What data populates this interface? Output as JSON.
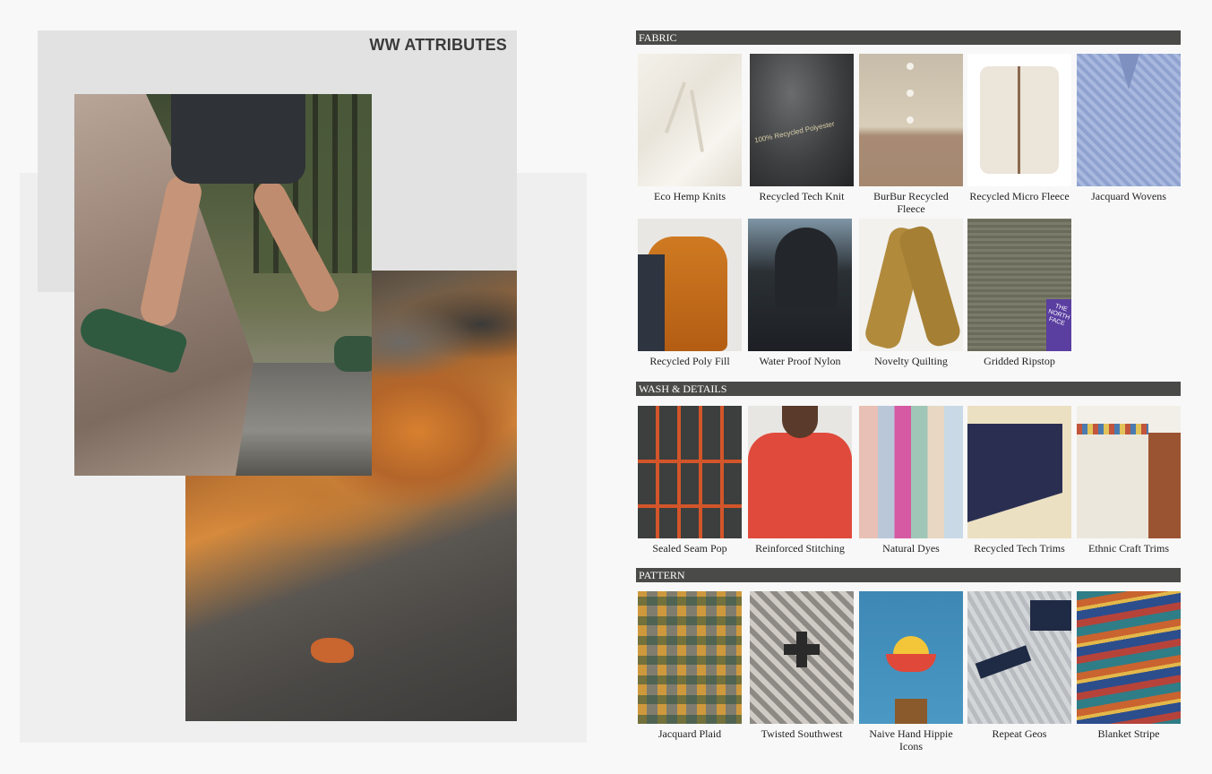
{
  "page_title": "WW ATTRIBUTES",
  "sections": {
    "fabric": {
      "label": "FABRIC",
      "items": [
        {
          "caption": "Eco Hemp Knits"
        },
        {
          "caption": "Recycled Tech Knit"
        },
        {
          "caption": "BurBur Recycled Fleece"
        },
        {
          "caption": "Recycled Micro Fleece"
        },
        {
          "caption": "Jacquard Wovens"
        },
        {
          "caption": "Recycled Poly Fill"
        },
        {
          "caption": "Water Proof Nylon"
        },
        {
          "caption": "Novelty Quilting"
        },
        {
          "caption": "Gridded Ripstop"
        }
      ]
    },
    "wash": {
      "label": "WASH & DETAILS",
      "items": [
        {
          "caption": "Sealed Seam Pop"
        },
        {
          "caption": "Reinforced Stitching"
        },
        {
          "caption": "Natural Dyes"
        },
        {
          "caption": "Recycled Tech Trims"
        },
        {
          "caption": "Ethnic Craft Trims"
        }
      ]
    },
    "pattern": {
      "label": "PATTERN",
      "items": [
        {
          "caption": "Jacquard Plaid"
        },
        {
          "caption": "Twisted Southwest"
        },
        {
          "caption": "Naive Hand Hippie Icons"
        },
        {
          "caption": "Repeat Geos"
        },
        {
          "caption": "Blanket Stripe"
        }
      ]
    }
  },
  "photo_texts": {
    "recycled_tech_knit_label": "100% Recycled Polyester",
    "jacket_tag": "THE NORTH FACE"
  }
}
